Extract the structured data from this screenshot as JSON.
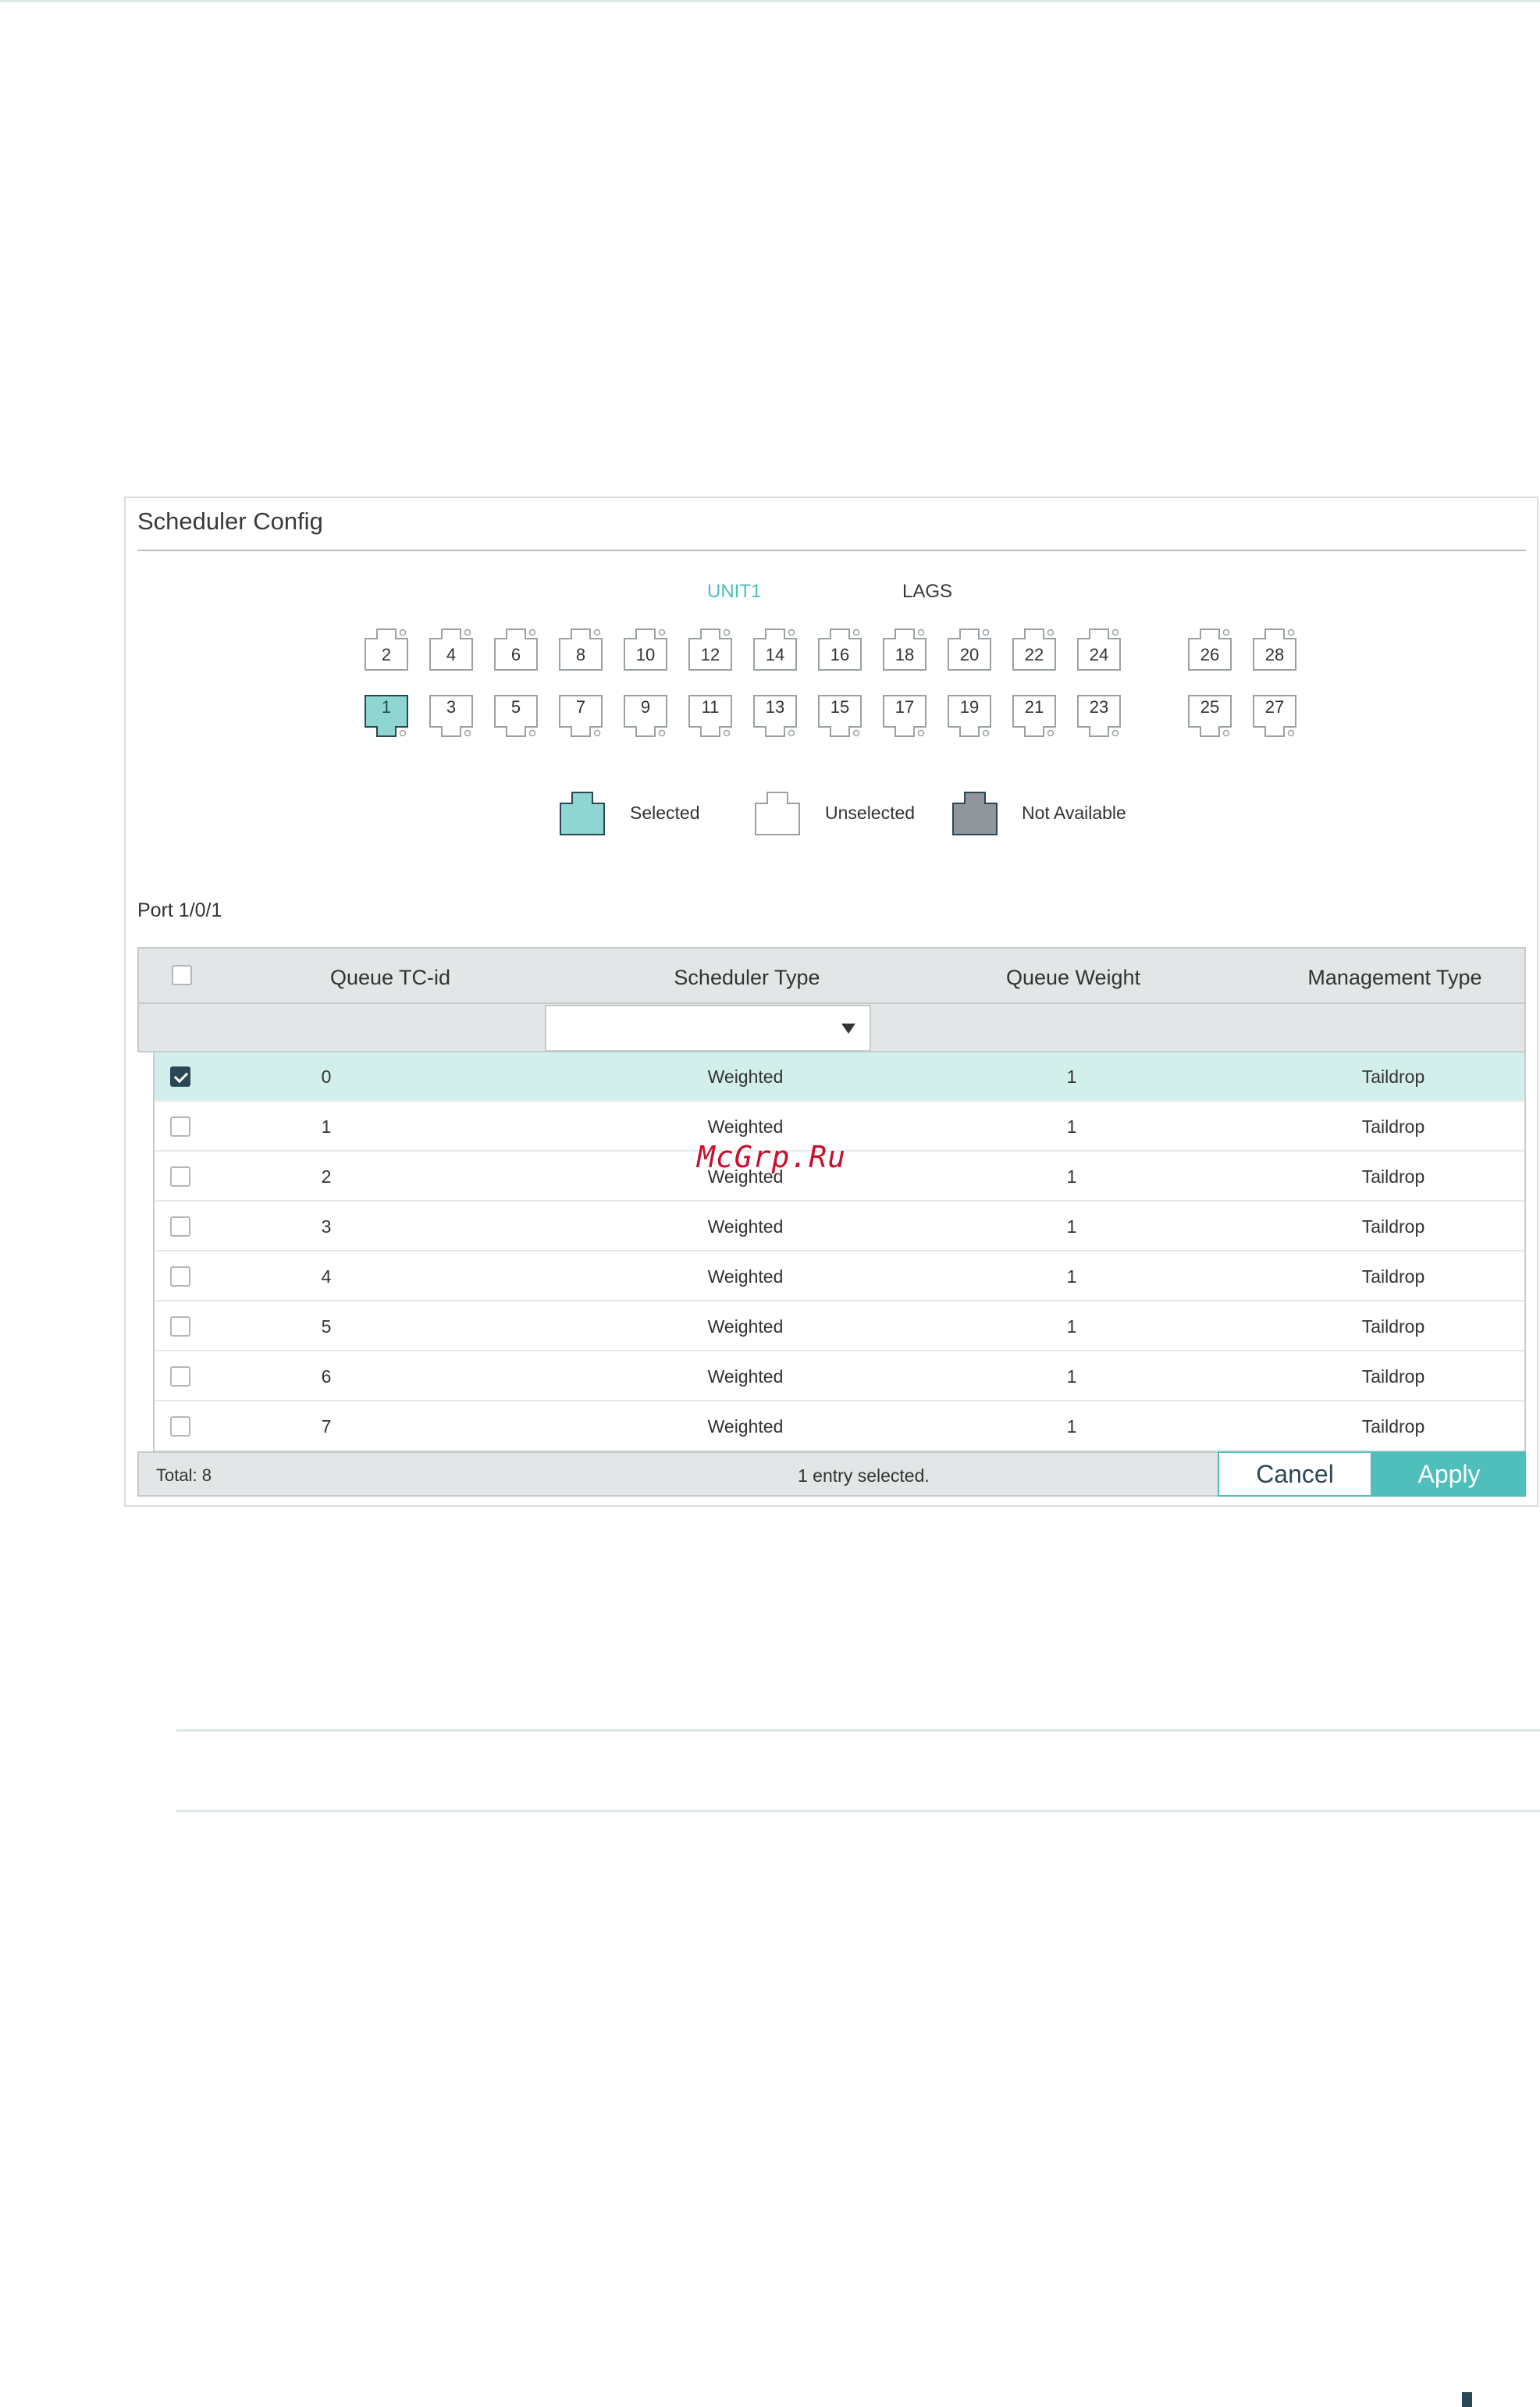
{
  "panel": {
    "title": "Scheduler Config",
    "tabs": {
      "unit": "UNIT1",
      "lags": "LAGS"
    }
  },
  "ports": {
    "top_row": [
      "2",
      "4",
      "6",
      "8",
      "10",
      "12",
      "14",
      "16",
      "18",
      "20",
      "22",
      "24",
      "26",
      "28"
    ],
    "bottom_row": [
      "1",
      "3",
      "5",
      "7",
      "9",
      "11",
      "13",
      "15",
      "17",
      "19",
      "21",
      "23",
      "25",
      "27"
    ],
    "selected": "1"
  },
  "legend": {
    "selected": "Selected",
    "unselected": "Unselected",
    "not_available": "Not Available"
  },
  "port_caption": "Port 1/0/1",
  "table": {
    "headers": [
      "Queue TC-id",
      "Scheduler Type",
      "Queue Weight",
      "Management Type"
    ],
    "filter_select_value": "",
    "rows": [
      {
        "tc": "0",
        "type": "Weighted",
        "weight": "1",
        "mgmt": "Taildrop"
      },
      {
        "tc": "1",
        "type": "Weighted",
        "weight": "1",
        "mgmt": "Taildrop"
      },
      {
        "tc": "2",
        "type": "Weighted",
        "weight": "1",
        "mgmt": "Taildrop"
      },
      {
        "tc": "3",
        "type": "Weighted",
        "weight": "1",
        "mgmt": "Taildrop"
      },
      {
        "tc": "4",
        "type": "Weighted",
        "weight": "1",
        "mgmt": "Taildrop"
      },
      {
        "tc": "5",
        "type": "Weighted",
        "weight": "1",
        "mgmt": "Taildrop"
      },
      {
        "tc": "6",
        "type": "Weighted",
        "weight": "1",
        "mgmt": "Taildrop"
      },
      {
        "tc": "7",
        "type": "Weighted",
        "weight": "1",
        "mgmt": "Taildrop"
      }
    ],
    "footer": {
      "total": "Total: 8",
      "entry_status": "1 entry selected."
    }
  },
  "buttons": {
    "cancel": "Cancel",
    "apply": "Apply"
  },
  "watermark": "McGrp.Ru",
  "colors": {
    "accent": "#4fbfbc",
    "dark": "#2b4756",
    "selected_row": "#d3efec",
    "not_available": "#8f959a"
  }
}
